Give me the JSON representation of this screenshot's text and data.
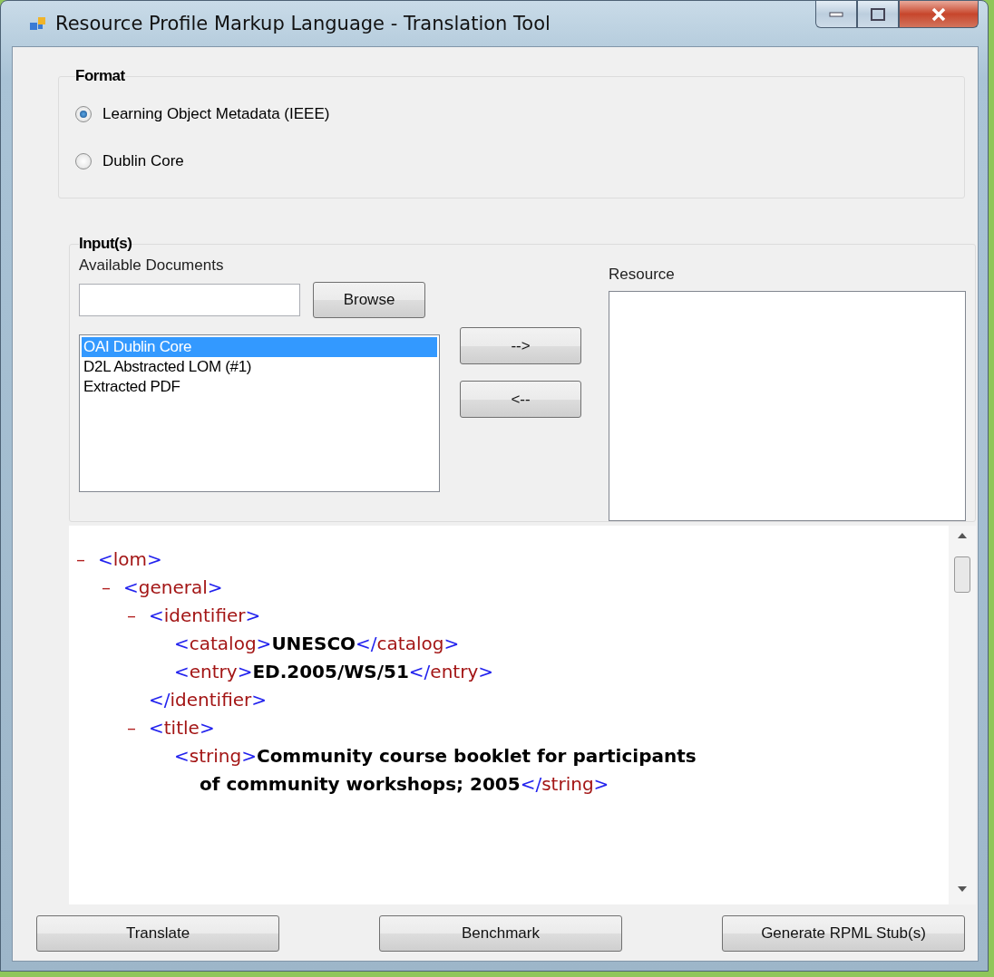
{
  "window": {
    "title": "Resource Profile Markup Language - Translation Tool"
  },
  "format": {
    "title": "Format",
    "options": [
      {
        "label": "Learning Object Metadata (IEEE)",
        "selected": true
      },
      {
        "label": "Dublin Core",
        "selected": false
      }
    ]
  },
  "inputs": {
    "title": "Input(s)",
    "available_label": "Available Documents",
    "browse": "Browse",
    "documents": [
      {
        "label": "OAI Dublin Core",
        "selected": true
      },
      {
        "label": "D2L Abstracted LOM (#1)",
        "selected": false
      },
      {
        "label": "Extracted PDF",
        "selected": false
      }
    ],
    "add": "-->",
    "remove": "<--",
    "resource_label": "Resource"
  },
  "xml": [
    {
      "toggle": "–",
      "open": "<lom>",
      "children": [
        {
          "toggle": "–",
          "open": "<general>",
          "children": [
            {
              "toggle": "–",
              "open": "<identifier>",
              "children": [
                {
                  "open": "<catalog>",
                  "value": "UNESCO",
                  "close": "</catalog>"
                },
                {
                  "open": "<entry>",
                  "value": "ED.2005/WS/51",
                  "close": "</entry>"
                }
              ],
              "close": "</identifier>"
            },
            {
              "toggle": "–",
              "open": "<title>",
              "children": [
                {
                  "open": "<string>",
                  "value": "Community course booklet for participants of community workshops; 2005",
                  "close": "</string>"
                }
              ]
            }
          ]
        }
      ]
    }
  ],
  "buttons": [
    "Translate",
    "Benchmark",
    "Generate RPML Stub(s)"
  ]
}
